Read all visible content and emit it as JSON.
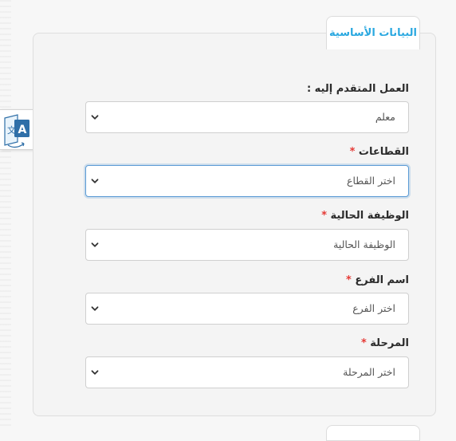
{
  "section": {
    "tab_title": "البيانات الأساسية"
  },
  "fields": [
    {
      "label": "العمل المتقدم إليه :",
      "required": false,
      "value": "معلم"
    },
    {
      "label": "القطاعات",
      "required": true,
      "value": "اختر القطاع"
    },
    {
      "label": "الوظيفة الحالية",
      "required": true,
      "value": "الوظيفة الحالية"
    },
    {
      "label": "اسم الفرع",
      "required": true,
      "value": "اختر الفرع"
    },
    {
      "label": "المرحلة",
      "required": true,
      "value": "اختر المرحلة"
    }
  ],
  "required_marker": "*",
  "icons": {
    "select_arrow": "chevron-down-icon",
    "translate": "translate-icon"
  },
  "colors": {
    "accent": "#2aa8e0",
    "required": "#e53935",
    "focus_border": "#5b9bd5"
  }
}
